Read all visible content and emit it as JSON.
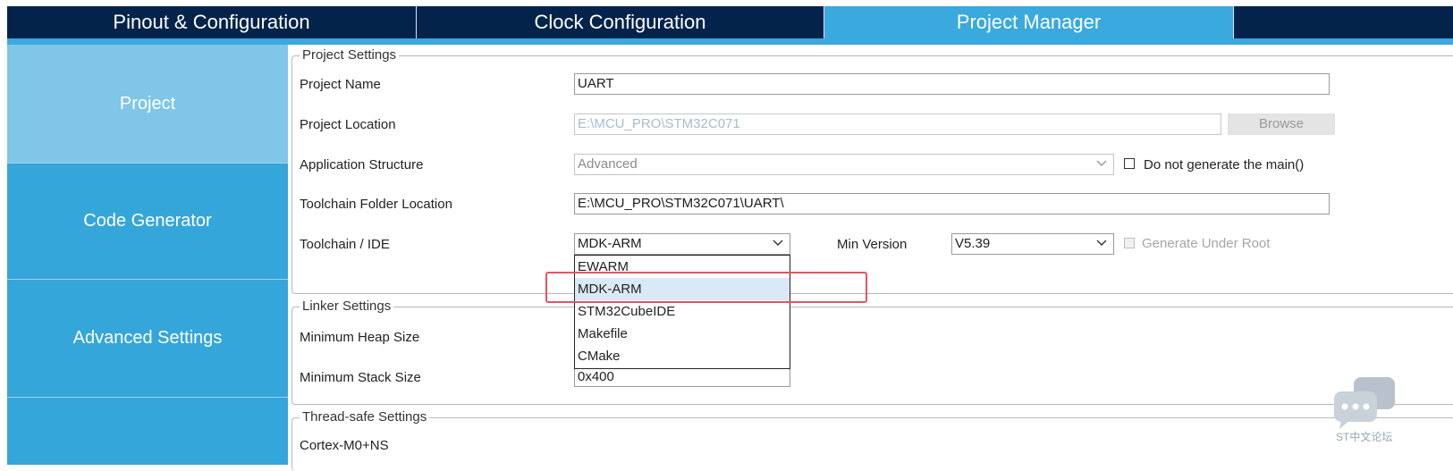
{
  "tabs": [
    {
      "label": "Pinout & Configuration"
    },
    {
      "label": "Clock Configuration"
    },
    {
      "label": "Project Manager"
    }
  ],
  "sidebar": {
    "items": [
      {
        "label": "Project"
      },
      {
        "label": "Code Generator"
      },
      {
        "label": "Advanced Settings"
      }
    ]
  },
  "project_settings": {
    "legend": "Project Settings",
    "project_name_label": "Project Name",
    "project_name_value": "UART",
    "project_location_label": "Project Location",
    "project_location_value": "E:\\MCU_PRO\\STM32C071",
    "browse_label": "Browse",
    "app_structure_label": "Application Structure",
    "app_structure_value": "Advanced",
    "no_main_label": "Do not generate the main()",
    "toolchain_folder_label": "Toolchain Folder Location",
    "toolchain_folder_value": "E:\\MCU_PRO\\STM32C071\\UART\\",
    "toolchain_label": "Toolchain / IDE",
    "toolchain_value": "MDK-ARM",
    "min_version_label": "Min Version",
    "min_version_value": "V5.39",
    "gen_under_root_label": "Generate Under Root"
  },
  "toolchain_options": [
    "EWARM",
    "MDK-ARM",
    "STM32CubeIDE",
    "Makefile",
    "CMake"
  ],
  "toolchain_selected": "MDK-ARM",
  "linker_settings": {
    "legend": "Linker Settings",
    "heap_label": "Minimum Heap Size",
    "stack_label": "Minimum Stack Size",
    "stack_value": "0x400"
  },
  "thread_safe": {
    "legend": "Thread-safe Settings",
    "core_label": "Cortex-M0+NS"
  },
  "watermark": {
    "text": "ST中文论坛"
  },
  "colors": {
    "tab_bar": "#03234b",
    "accent": "#3aa9dd",
    "nav_active": "#7fc6e8",
    "highlight": "#e25563"
  }
}
